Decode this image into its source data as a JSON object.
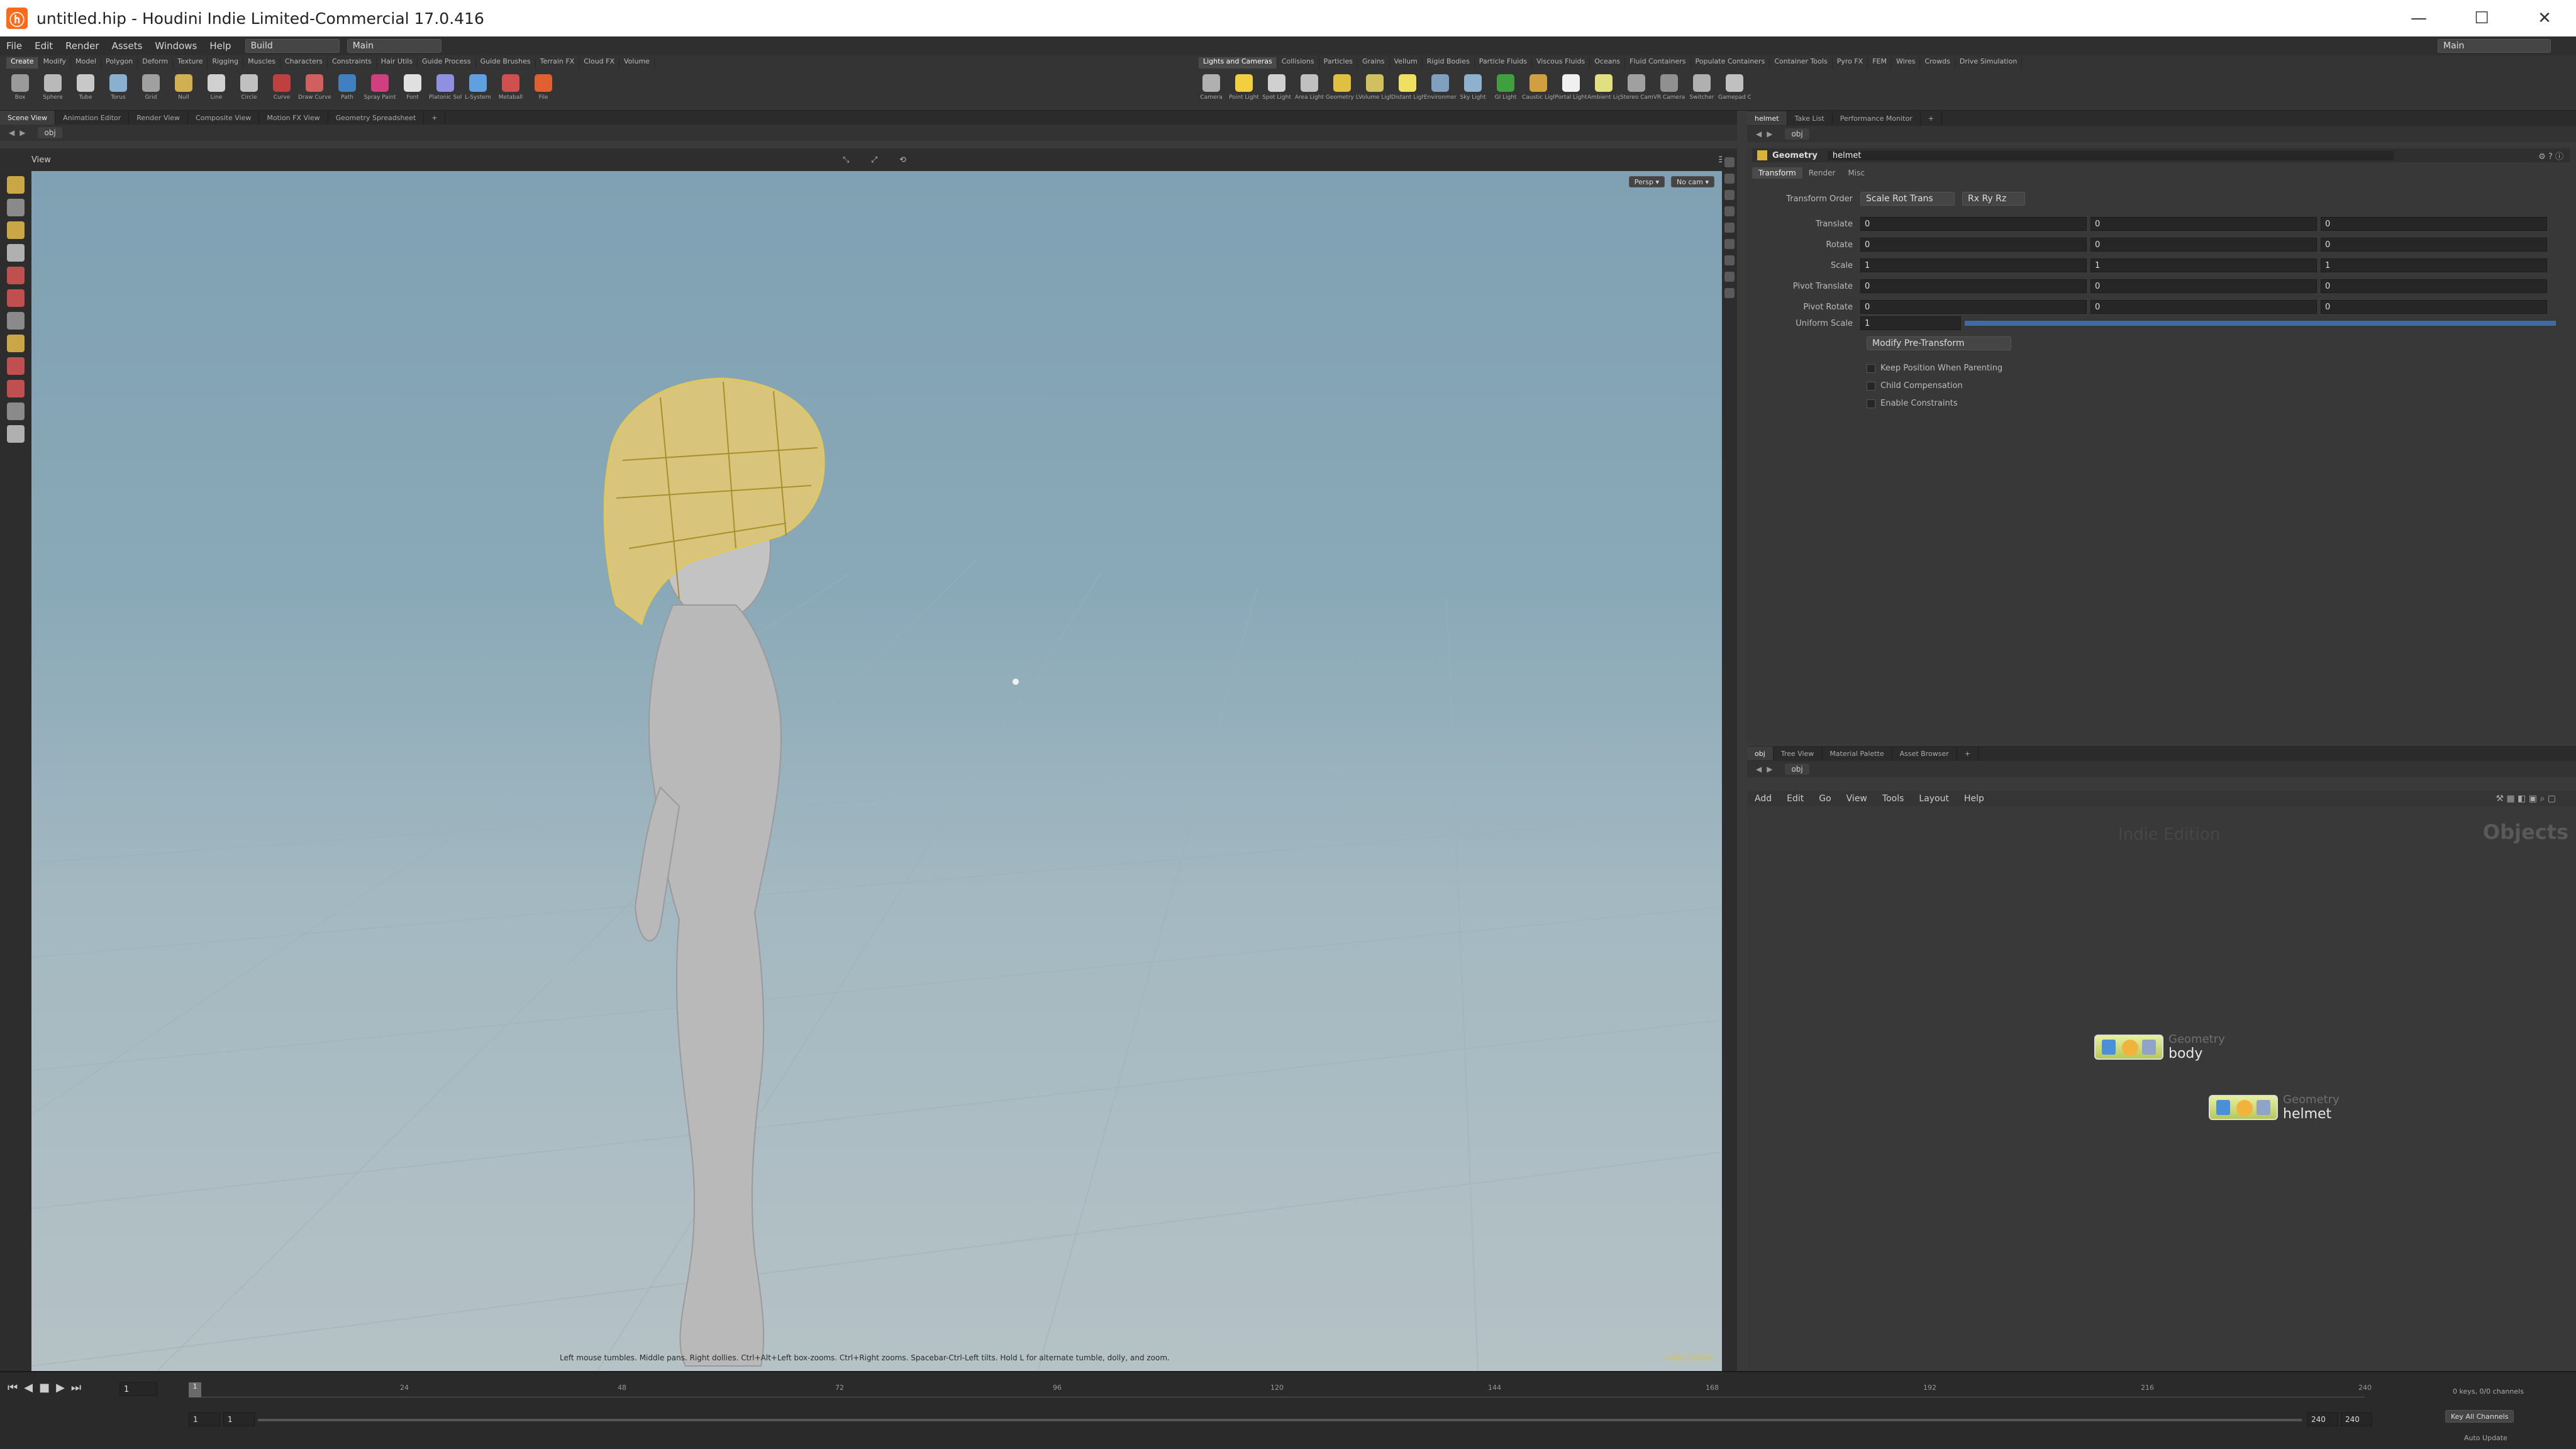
{
  "window": {
    "title": "untitled.hip - Houdini Indie Limited-Commercial 17.0.416",
    "minimize": "—",
    "maximize": "☐",
    "close": "✕"
  },
  "menubar": {
    "items": [
      "File",
      "Edit",
      "Render",
      "Assets",
      "Windows",
      "Help"
    ],
    "build_dropdown": "Build",
    "desktop_dropdown": "Main"
  },
  "shelf": {
    "left_tabs": [
      "Create",
      "Modify",
      "Model",
      "Polygon",
      "Deform",
      "Texture",
      "Rigging",
      "Muscles",
      "Characters",
      "Constraints",
      "Hair Utils",
      "Guide Process",
      "Guide Brushes",
      "Terrain FX",
      "Cloud FX",
      "Volume"
    ],
    "left_tools": [
      "Box",
      "Sphere",
      "Tube",
      "Torus",
      "Grid",
      "Null",
      "Line",
      "Circle",
      "Curve",
      "Draw Curve",
      "Path",
      "Spray Paint",
      "Font",
      "Platonic Solids",
      "L-System",
      "Metaball",
      "File"
    ],
    "right_tabs": [
      "Lights and Cameras",
      "Collisions",
      "Particles",
      "Grains",
      "Vellum",
      "Rigid Bodies",
      "Particle Fluids",
      "Viscous Fluids",
      "Oceans",
      "Fluid Containers",
      "Populate Containers",
      "Container Tools",
      "Pyro FX",
      "FEM",
      "Wires",
      "Crowds",
      "Drive Simulation"
    ],
    "right_tools": [
      "Camera",
      "Point Light",
      "Spot Light",
      "Area Light",
      "Geometry Light",
      "Volume Light",
      "Distant Light",
      "Environment Light",
      "Sky Light",
      "GI Light",
      "Caustic Light",
      "Portal Light",
      "Ambient Light",
      "Stereo Camera",
      "VR Camera",
      "Switcher",
      "Gamepad Camera"
    ],
    "desktop_label": "Main"
  },
  "viewport_pane": {
    "tabs": [
      "Scene View",
      "Animation Editor",
      "Render View",
      "Composite View",
      "Motion FX View",
      "Geometry Spreadsheet"
    ],
    "path": "obj",
    "view_label": "View",
    "persp_label": "Persp ▾",
    "cam_label": "No cam ▾",
    "status_hint": "Left mouse tumbles. Middle pans. Right dollies. Ctrl+Alt+Left box-zooms. Ctrl+Right zooms. Spacebar-Ctrl-Left tilts. Hold L for alternate tumble, dolly, and zoom.",
    "corner_label": "Indie Edition"
  },
  "param_pane": {
    "tabs": [
      "helmet",
      "Take List",
      "Performance Monitor"
    ],
    "path": "obj",
    "node_type": "Geometry",
    "node_name": "helmet",
    "sub_tabs": [
      "Transform",
      "Render",
      "Misc"
    ],
    "transform_order_label": "Transform Order",
    "transform_order": "Scale Rot Trans",
    "rotate_order": "Rx Ry Rz",
    "rows": [
      {
        "label": "Translate",
        "values": [
          "0",
          "0",
          "0"
        ]
      },
      {
        "label": "Rotate",
        "values": [
          "0",
          "0",
          "0"
        ]
      },
      {
        "label": "Scale",
        "values": [
          "1",
          "1",
          "1"
        ]
      },
      {
        "label": "Pivot Translate",
        "values": [
          "0",
          "0",
          "0"
        ]
      },
      {
        "label": "Pivot Rotate",
        "values": [
          "0",
          "0",
          "0"
        ]
      }
    ],
    "uniform_scale_label": "Uniform Scale",
    "uniform_scale": "1",
    "modify_button": "Modify Pre-Transform",
    "checkboxes": [
      "Keep Position When Parenting",
      "Child Compensation",
      "Enable Constraints"
    ]
  },
  "network_pane": {
    "tabs": [
      "obj",
      "Tree View",
      "Material Palette",
      "Asset Browser"
    ],
    "path": "obj",
    "menu": [
      "Add",
      "Edit",
      "Go",
      "View",
      "Tools",
      "Layout",
      "Help"
    ],
    "watermark": "Indie Edition",
    "context_label": "Objects",
    "nodes": [
      {
        "type": "Geometry",
        "name": "body"
      },
      {
        "type": "Geometry",
        "name": "helmet"
      }
    ]
  },
  "timeline": {
    "current_frame": "1",
    "start_frame": "1",
    "start_frame2": "1",
    "end_frame": "240",
    "end_frame2": "240",
    "ticks": [
      "24",
      "48",
      "72",
      "96",
      "120",
      "144",
      "168",
      "192",
      "216",
      "240"
    ],
    "keys_label": "0 keys, 0/0 channels",
    "key_all_label": "Key All Channels",
    "auto_update": "Auto Update"
  }
}
